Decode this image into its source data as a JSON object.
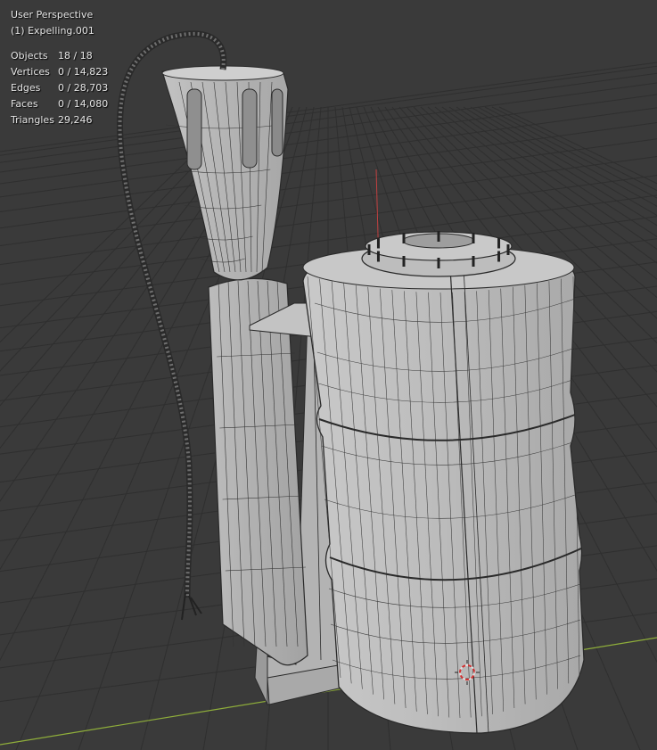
{
  "viewport": {
    "view_name": "User Perspective",
    "active_object": "(1) Expelling.001"
  },
  "statistics": [
    {
      "key": "objects",
      "label": "Objects",
      "value": "18 / 18"
    },
    {
      "key": "vertices",
      "label": "Vertices",
      "value": "0 / 14,823"
    },
    {
      "key": "edges",
      "label": "Edges",
      "value": "0 / 28,703"
    },
    {
      "key": "faces",
      "label": "Faces",
      "value": "0 / 14,080"
    },
    {
      "key": "triangles",
      "label": "Triangles",
      "value": "29,246"
    }
  ],
  "colors": {
    "background": "#3a3a3a",
    "grid_line": "#2f2f2f",
    "x_axis": "#8fae3a",
    "z_axis": "#c04040",
    "mesh_fill": "#b9b9b9",
    "wire": "#2a2a2a"
  },
  "scene": {
    "objects": [
      "hose",
      "funnel",
      "pole",
      "bracket",
      "back-plate",
      "tank",
      "tank-lid",
      "3d-cursor"
    ]
  }
}
